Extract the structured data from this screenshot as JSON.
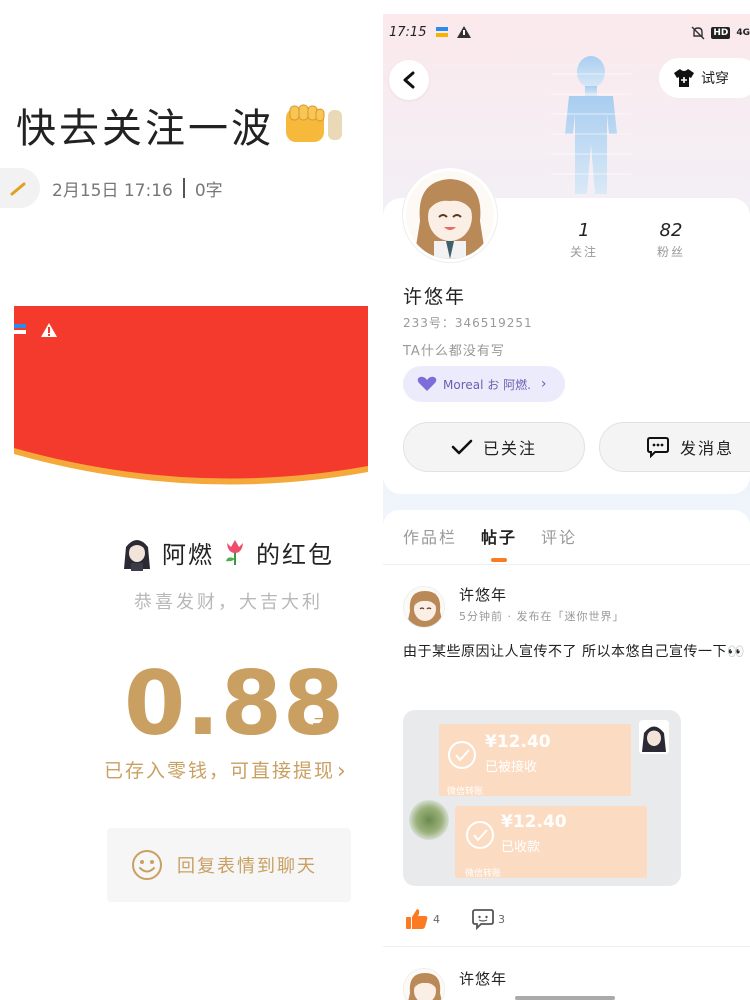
{
  "left": {
    "title": "快去关注一波",
    "date": "2月15日 17:16",
    "word_count": "0字",
    "red_packet": {
      "sender": "阿燃",
      "sender_suffix": "的红包",
      "wish": "恭喜发财，大吉大利",
      "amount": "0.88",
      "unit": "元",
      "saved_text": "已存入零钱，可直接提现",
      "reply_text": "回复表情到聊天"
    },
    "colors": {
      "banner_red": "#f43a2c",
      "gold": "#c9a062"
    }
  },
  "right": {
    "status_bar": {
      "time": "17:15",
      "hd": "HD",
      "signal": "4G"
    },
    "try_on_label": "试穿",
    "profile": {
      "follow_count": "1",
      "follow_label": "关注",
      "fans_count": "82",
      "fans_label": "粉丝",
      "name": "许悠年",
      "id_text": "233号：346519251",
      "bio": "TA什么都没有写",
      "relation_text": "Moreal お 阿燃.",
      "followed_label": "已关注",
      "message_label": "发消息"
    },
    "tabs": [
      "作品栏",
      "帖子",
      "评论"
    ],
    "active_tab": "帖子",
    "post": {
      "author": "许悠年",
      "meta": "5分钟前 · 发布在「迷你世界」",
      "text": "由于某些原因让人宣传不了 所以本悠自己宣传一下👀",
      "transfer1": {
        "amount": "¥12.40",
        "status": "已被接收",
        "foot": "微信转账"
      },
      "transfer2": {
        "amount": "¥12.40",
        "status": "已收款",
        "foot": "微信转账"
      },
      "like_count": "4",
      "comment_count": "3"
    },
    "post2": {
      "author": "许悠年"
    },
    "colors": {
      "accent_orange": "#fb7a22",
      "chip_purple": "#6a5fb0",
      "transfer_peach": "#fbdcc2"
    }
  }
}
